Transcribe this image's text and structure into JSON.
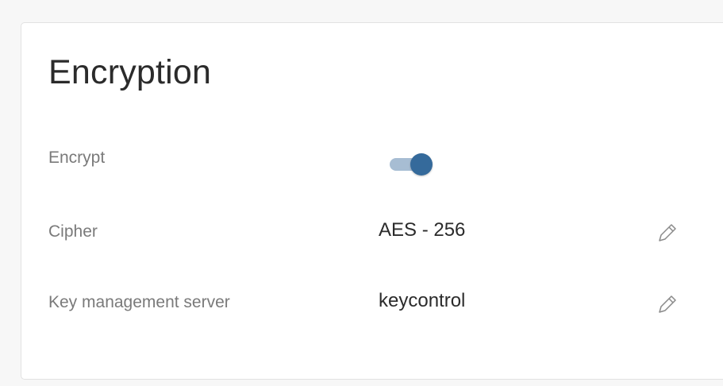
{
  "section": {
    "title": "Encryption"
  },
  "rows": {
    "encrypt": {
      "label": "Encrypt",
      "toggle_on": true
    },
    "cipher": {
      "label": "Cipher",
      "value": "AES - 256",
      "edit_icon": "pencil-icon"
    },
    "kms": {
      "label": "Key management server",
      "value": "keycontrol",
      "edit_icon": "pencil-icon"
    }
  },
  "colors": {
    "toggle_track": "#a7bdd3",
    "toggle_knob": "#356a9b",
    "edit_icon": "#8a8a8a"
  }
}
